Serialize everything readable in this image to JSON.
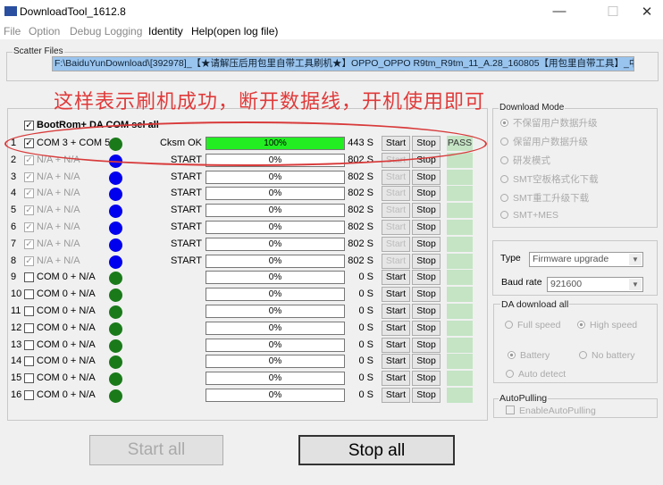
{
  "window": {
    "title": "DownloadTool_1612.8",
    "minimize": "—",
    "maximize": "☐",
    "close": "✕"
  },
  "menu": [
    {
      "label": "File",
      "enabled": false
    },
    {
      "label": "Option",
      "enabled": false
    },
    {
      "label": "Debug Logging",
      "enabled": false
    },
    {
      "label": "Identity",
      "enabled": true
    },
    {
      "label": "Help(open log file)",
      "enabled": true
    }
  ],
  "scatter": {
    "label": "Scatter Files",
    "path": "F:\\BaiduYunDownload\\[392978]_【★请解压后用包里自带工具刷机★】OPPO_OPPO R9tm_R9tm_11_A.28_160805【用包里自带工具】_中国"
  },
  "annotation": "这样表示刷机成功，断开数据线，开机使用即可",
  "colors": {
    "annotation": "#e03a3a",
    "progress_fill": "#22ee22",
    "dot_green": "#1a7a1a",
    "dot_blue": "#0000ee",
    "pass_bg": "#c4e4c4"
  },
  "select_all": {
    "label": "BootRom+ DA COM sel all",
    "checked": true
  },
  "rows": [
    {
      "index": "1",
      "checked": true,
      "enabled": true,
      "port": "COM 3 + COM 5",
      "dot": "green",
      "status": "Cksm OK",
      "progress": 100,
      "progress_text": "100%",
      "time": "443 S",
      "start": "Start",
      "stop": "Stop",
      "result": "PASS"
    },
    {
      "index": "2",
      "checked": true,
      "enabled": false,
      "port": "N/A + N/A",
      "dot": "blue",
      "status": "START",
      "progress": 0,
      "progress_text": "0%",
      "time": "802 S",
      "start": "Start",
      "stop": "Stop",
      "result": ""
    },
    {
      "index": "3",
      "checked": true,
      "enabled": false,
      "port": "N/A + N/A",
      "dot": "blue",
      "status": "START",
      "progress": 0,
      "progress_text": "0%",
      "time": "802 S",
      "start": "Start",
      "stop": "Stop",
      "result": ""
    },
    {
      "index": "4",
      "checked": true,
      "enabled": false,
      "port": "N/A + N/A",
      "dot": "blue",
      "status": "START",
      "progress": 0,
      "progress_text": "0%",
      "time": "802 S",
      "start": "Start",
      "stop": "Stop",
      "result": ""
    },
    {
      "index": "5",
      "checked": true,
      "enabled": false,
      "port": "N/A + N/A",
      "dot": "blue",
      "status": "START",
      "progress": 0,
      "progress_text": "0%",
      "time": "802 S",
      "start": "Start",
      "stop": "Stop",
      "result": ""
    },
    {
      "index": "6",
      "checked": true,
      "enabled": false,
      "port": "N/A + N/A",
      "dot": "blue",
      "status": "START",
      "progress": 0,
      "progress_text": "0%",
      "time": "802 S",
      "start": "Start",
      "stop": "Stop",
      "result": ""
    },
    {
      "index": "7",
      "checked": true,
      "enabled": false,
      "port": "N/A + N/A",
      "dot": "blue",
      "status": "START",
      "progress": 0,
      "progress_text": "0%",
      "time": "802 S",
      "start": "Start",
      "stop": "Stop",
      "result": ""
    },
    {
      "index": "8",
      "checked": true,
      "enabled": false,
      "port": "N/A + N/A",
      "dot": "blue",
      "status": "START",
      "progress": 0,
      "progress_text": "0%",
      "time": "802 S",
      "start": "Start",
      "stop": "Stop",
      "result": ""
    },
    {
      "index": "9",
      "checked": false,
      "enabled": true,
      "port": "COM 0 + N/A",
      "dot": "green",
      "status": "",
      "progress": 0,
      "progress_text": "0%",
      "time": "0 S",
      "start": "Start",
      "stop": "Stop",
      "result": ""
    },
    {
      "index": "10",
      "checked": false,
      "enabled": true,
      "port": "COM 0 + N/A",
      "dot": "green",
      "status": "",
      "progress": 0,
      "progress_text": "0%",
      "time": "0 S",
      "start": "Start",
      "stop": "Stop",
      "result": ""
    },
    {
      "index": "11",
      "checked": false,
      "enabled": true,
      "port": "COM 0 + N/A",
      "dot": "green",
      "status": "",
      "progress": 0,
      "progress_text": "0%",
      "time": "0 S",
      "start": "Start",
      "stop": "Stop",
      "result": ""
    },
    {
      "index": "12",
      "checked": false,
      "enabled": true,
      "port": "COM 0 + N/A",
      "dot": "green",
      "status": "",
      "progress": 0,
      "progress_text": "0%",
      "time": "0 S",
      "start": "Start",
      "stop": "Stop",
      "result": ""
    },
    {
      "index": "13",
      "checked": false,
      "enabled": true,
      "port": "COM 0 + N/A",
      "dot": "green",
      "status": "",
      "progress": 0,
      "progress_text": "0%",
      "time": "0 S",
      "start": "Start",
      "stop": "Stop",
      "result": ""
    },
    {
      "index": "14",
      "checked": false,
      "enabled": true,
      "port": "COM 0 + N/A",
      "dot": "green",
      "status": "",
      "progress": 0,
      "progress_text": "0%",
      "time": "0 S",
      "start": "Start",
      "stop": "Stop",
      "result": ""
    },
    {
      "index": "15",
      "checked": false,
      "enabled": true,
      "port": "COM 0 + N/A",
      "dot": "green",
      "status": "",
      "progress": 0,
      "progress_text": "0%",
      "time": "0 S",
      "start": "Start",
      "stop": "Stop",
      "result": ""
    },
    {
      "index": "16",
      "checked": false,
      "enabled": true,
      "port": "COM 0 + N/A",
      "dot": "green",
      "status": "",
      "progress": 0,
      "progress_text": "0%",
      "time": "0 S",
      "start": "Start",
      "stop": "Stop",
      "result": ""
    }
  ],
  "download_mode": {
    "label": "Download Mode",
    "options": [
      "不保留用户数据升级",
      "保留用户数据升级",
      "研发模式",
      "SMT空板格式化下载",
      "SMT重工升级下载",
      "SMT+MES"
    ],
    "selected": 0
  },
  "type": {
    "label": "Type",
    "value": "Firmware upgrade"
  },
  "baud": {
    "label": "Baud rate",
    "value": "921600"
  },
  "da": {
    "label": "DA download all",
    "full": "Full speed",
    "high": "High speed",
    "battery": "Battery",
    "no_battery": "No battery",
    "auto": "Auto detect"
  },
  "autopulling": {
    "label": "AutoPulling",
    "checkbox": "EnableAutoPulling"
  },
  "actions": {
    "start_all": "Start all",
    "stop_all": "Stop all"
  }
}
